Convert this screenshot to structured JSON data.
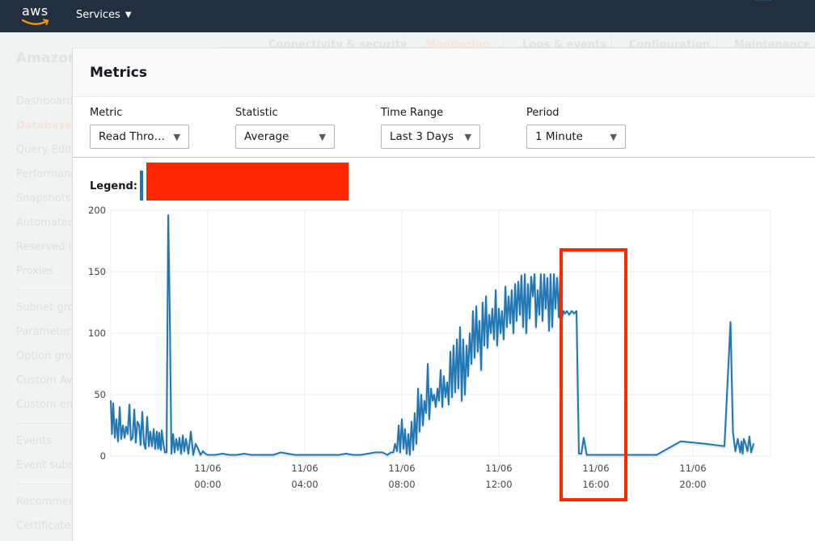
{
  "topbar": {
    "logo_text": "aws",
    "services_label": "Services",
    "services_caret": "▼"
  },
  "background_page": {
    "title": "Amazon",
    "tabs": [
      {
        "label": "Connectivity & security",
        "active": false
      },
      {
        "label": "Monitoring",
        "active": true
      },
      {
        "label": "Logs & events",
        "active": false
      },
      {
        "label": "Configuration",
        "active": false
      },
      {
        "label": "Maintenance &",
        "active": false
      }
    ],
    "nav_groups": [
      [
        "Dashboard",
        "Databases",
        "Query Edito",
        "Performanc",
        "Snapshots",
        "Automated",
        "Reserved in",
        "Proxies"
      ],
      [
        "Subnet gro",
        "Parameter",
        "Option gro",
        "Custom Ava",
        "Custom en"
      ],
      [
        "Events",
        "Event subs"
      ],
      [
        "Recommen",
        "Certificate"
      ]
    ],
    "nav_active": "Databases"
  },
  "modal": {
    "title": "Metrics",
    "controls": [
      {
        "label": "Metric",
        "value": "Read Thro…"
      },
      {
        "label": "Statistic",
        "value": "Average"
      },
      {
        "label": "Time Range",
        "value": "Last 3 Days"
      },
      {
        "label": "Period",
        "value": "1 Minute"
      }
    ],
    "legend_label": "Legend:",
    "legend_color": "#1f77b4",
    "redaction_color": "#ff2600"
  },
  "chart_data": {
    "type": "line",
    "title": "",
    "xlabel": "",
    "ylabel": "",
    "series_color": "#1f77b4",
    "ylim": [
      0,
      200
    ],
    "yticks": [
      0,
      50,
      100,
      150,
      200
    ],
    "xlim_hours": [
      -4,
      23.2
    ],
    "xticks": [
      {
        "hour": 0,
        "date": "11/06",
        "time": "00:00"
      },
      {
        "hour": 4,
        "date": "11/06",
        "time": "04:00"
      },
      {
        "hour": 8,
        "date": "11/06",
        "time": "08:00"
      },
      {
        "hour": 12,
        "date": "11/06",
        "time": "12:00"
      },
      {
        "hour": 16,
        "date": "11/06",
        "time": "16:00"
      },
      {
        "hour": 20,
        "date": "11/06",
        "time": "20:00"
      }
    ],
    "grid": true,
    "legend_position": "top-left",
    "highlight_region_hours": [
      14.5,
      17.3
    ],
    "x_hours": [
      -4.0,
      -3.95,
      -3.9,
      -3.83,
      -3.77,
      -3.7,
      -3.63,
      -3.57,
      -3.5,
      -3.43,
      -3.37,
      -3.3,
      -3.23,
      -3.17,
      -3.1,
      -3.03,
      -2.97,
      -2.9,
      -2.83,
      -2.77,
      -2.7,
      -2.63,
      -2.57,
      -2.5,
      -2.43,
      -2.37,
      -2.3,
      -2.23,
      -2.17,
      -2.1,
      -2.05,
      -2.0,
      -1.97,
      -1.93,
      -1.9,
      -1.83,
      -1.77,
      -1.7,
      -1.63,
      -1.57,
      -1.5,
      -1.43,
      -1.37,
      -1.3,
      -1.23,
      -1.17,
      -1.1,
      -1.03,
      -0.97,
      -0.9,
      -0.8,
      -0.7,
      -0.6,
      -0.5,
      -0.4,
      -0.3,
      -0.2,
      -0.1,
      0.0,
      0.3,
      0.6,
      0.9,
      1.2,
      1.5,
      1.8,
      2.0,
      2.1,
      2.4,
      2.7,
      3.0,
      3.3,
      3.6,
      3.9,
      4.2,
      4.5,
      4.8,
      5.1,
      5.4,
      5.7,
      6.0,
      6.3,
      6.6,
      6.9,
      7.2,
      7.4,
      7.55,
      7.65,
      7.72,
      7.8,
      7.87,
      7.93,
      8.0,
      8.07,
      8.13,
      8.2,
      8.27,
      8.33,
      8.4,
      8.47,
      8.53,
      8.6,
      8.67,
      8.73,
      8.8,
      8.87,
      8.93,
      9.0,
      9.07,
      9.13,
      9.2,
      9.27,
      9.33,
      9.4,
      9.47,
      9.53,
      9.6,
      9.67,
      9.73,
      9.8,
      9.87,
      9.93,
      10.0,
      10.07,
      10.13,
      10.2,
      10.27,
      10.33,
      10.4,
      10.47,
      10.53,
      10.6,
      10.67,
      10.73,
      10.8,
      10.87,
      10.93,
      11.0,
      11.07,
      11.13,
      11.2,
      11.27,
      11.33,
      11.4,
      11.47,
      11.53,
      11.6,
      11.67,
      11.73,
      11.8,
      11.87,
      11.93,
      12.0,
      12.07,
      12.13,
      12.2,
      12.27,
      12.33,
      12.4,
      12.47,
      12.53,
      12.6,
      12.67,
      12.73,
      12.8,
      12.87,
      12.93,
      13.0,
      13.07,
      13.13,
      13.2,
      13.27,
      13.33,
      13.4,
      13.47,
      13.53,
      13.6,
      13.67,
      13.73,
      13.8,
      13.87,
      13.93,
      14.0,
      14.07,
      14.13,
      14.2,
      14.27,
      14.33,
      14.4,
      14.47,
      14.53,
      14.6,
      14.67,
      14.73,
      14.8,
      14.9,
      15.0,
      15.1,
      15.2,
      15.3,
      15.4,
      15.5,
      15.62,
      15.72,
      15.9,
      16.0,
      16.1,
      16.2,
      16.6,
      17.5,
      18.5,
      19.5,
      20.5,
      21.3,
      21.55,
      21.65,
      21.75,
      21.85,
      21.95,
      22.0,
      22.05,
      22.1,
      22.17,
      22.25,
      22.33,
      22.4,
      22.5,
      22.6,
      22.7,
      22.8,
      22.9,
      23.0,
      23.1,
      23.2
    ],
    "values": [
      45,
      18,
      43,
      15,
      30,
      12,
      40,
      14,
      25,
      15,
      24,
      18,
      42,
      13,
      15,
      38,
      11,
      28,
      25,
      9,
      36,
      10,
      6,
      32,
      8,
      20,
      8,
      22,
      6,
      20,
      6,
      19,
      8,
      5,
      21,
      10,
      3,
      3,
      196,
      120,
      2,
      18,
      3,
      14,
      5,
      15,
      2,
      17,
      4,
      14,
      2,
      20,
      1,
      10,
      6,
      1,
      4,
      2,
      1,
      1,
      2,
      1,
      1,
      2,
      1,
      1,
      1,
      1,
      1,
      3,
      2,
      1,
      1,
      1,
      1,
      1,
      1,
      1,
      2,
      1,
      1,
      2,
      3,
      3,
      1,
      3,
      3,
      10,
      4,
      25,
      3,
      30,
      6,
      22,
      2,
      18,
      1,
      28,
      5,
      35,
      10,
      55,
      20,
      50,
      25,
      45,
      35,
      75,
      30,
      55,
      45,
      50,
      40,
      55,
      45,
      70,
      40,
      65,
      48,
      60,
      42,
      85,
      48,
      90,
      52,
      95,
      55,
      105,
      45,
      95,
      50,
      90,
      65,
      100,
      75,
      118,
      80,
      122,
      85,
      110,
      70,
      125,
      90,
      130,
      88,
      115,
      100,
      120,
      95,
      135,
      90,
      120,
      100,
      118,
      95,
      138,
      105,
      130,
      108,
      135,
      100,
      140,
      110,
      142,
      115,
      147,
      105,
      148,
      100,
      140,
      112,
      146,
      130,
      148,
      105,
      135,
      115,
      148,
      110,
      148,
      120,
      145,
      102,
      148,
      105,
      148,
      120,
      145,
      113,
      148,
      112,
      118,
      116,
      118,
      115,
      118,
      116,
      118,
      2,
      2,
      15,
      1,
      1,
      1,
      1,
      1,
      1,
      1,
      1,
      1,
      12,
      10,
      8,
      109,
      20,
      4,
      14,
      3,
      12,
      2,
      14,
      10,
      4,
      16,
      3,
      10
    ]
  }
}
